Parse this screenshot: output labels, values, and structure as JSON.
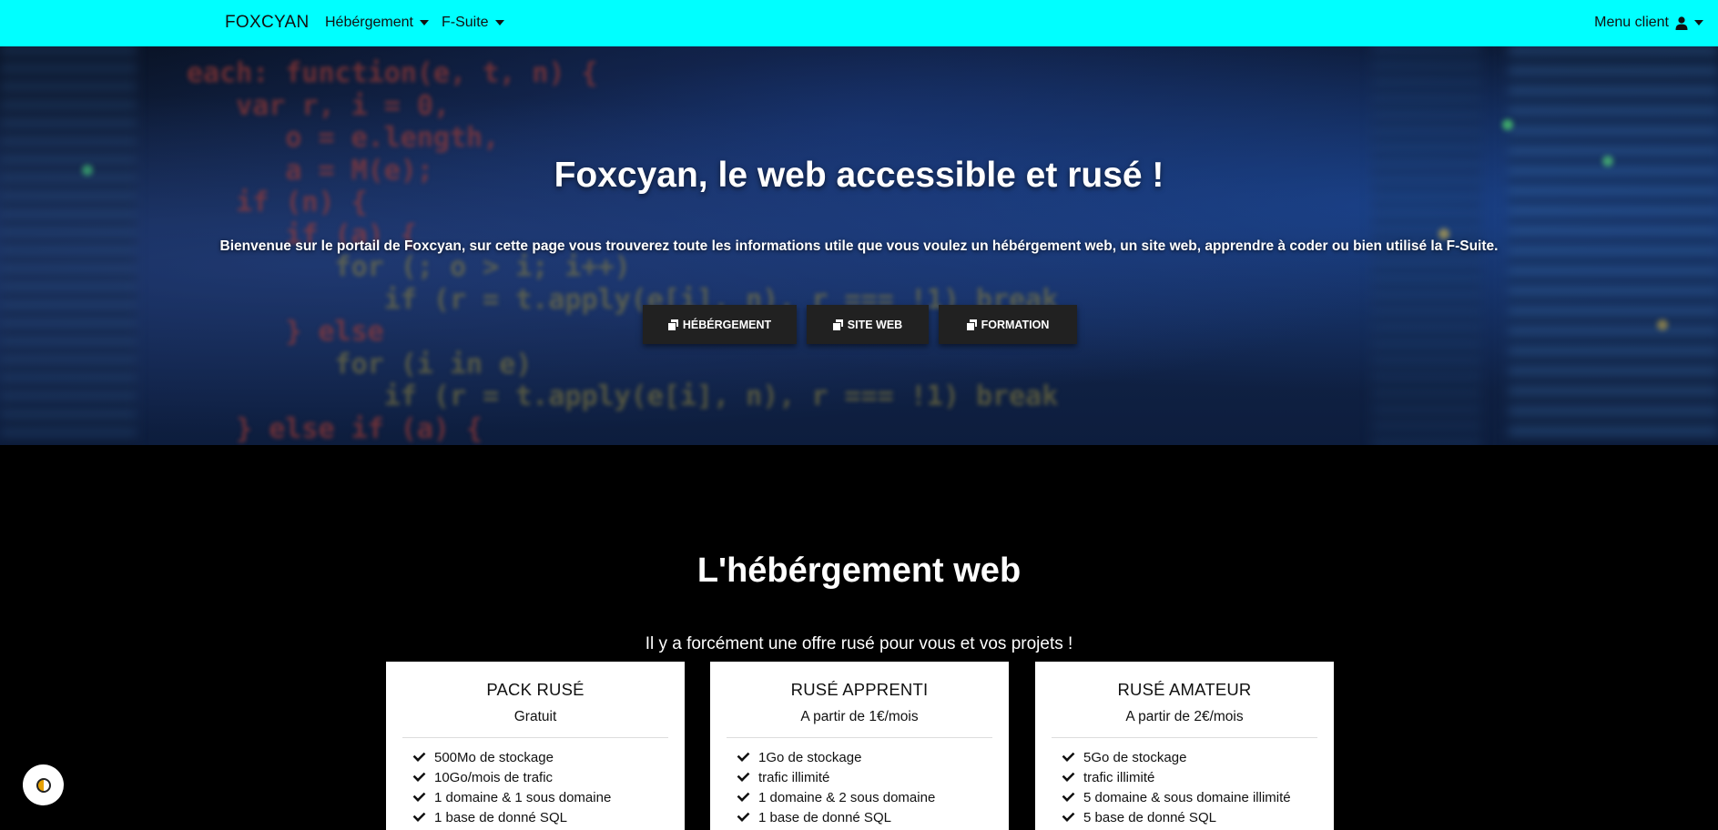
{
  "navbar": {
    "brand": "FOXCYAN",
    "items": [
      {
        "label": "Hébérgement"
      },
      {
        "label": "F-Suite"
      }
    ],
    "client_menu": "Menu client",
    "client_icon": "user-icon",
    "bg_color": "#00ffff"
  },
  "hero": {
    "title": "Foxcyan, le web accessible et rusé !",
    "description": "Bienvenue sur le portail de Foxcyan, sur cette page vous trouverez toute les informations utile que vous voulez un hébérgement web, un site web, apprendre à coder ou bien utilisé la F-Suite.",
    "code_lines": [
      "each: function(e, t, n) {",
      "   var r, i = 0,",
      "      o = e.length,",
      "      a = M(e);",
      "   if (n) {",
      "      if (a) {",
      "         for (; o > i; i++)",
      "            if (r = t.apply(e[i], n), r === !1) break",
      "      } else",
      "         for (i in e)",
      "            if (r = t.apply(e[i], n), r === !1) break",
      "   } else if (a) {"
    ],
    "buttons": [
      {
        "label": "HÉBÉRGEMENT",
        "icon": "copy-icon"
      },
      {
        "label": "SITE WEB",
        "icon": "copy-icon"
      },
      {
        "label": "FORMATION",
        "icon": "copy-icon"
      }
    ]
  },
  "hosting": {
    "title": "L'hébérgement web",
    "subtitle": "Il y a forcément une offre rusé pour vous et vos projets !",
    "plans": [
      {
        "name": "PACK RUSÉ",
        "price": "Gratuit",
        "features": [
          "500Mo de stockage",
          "10Go/mois de trafic",
          "1 domaine & 1 sous domaine",
          "1 base de donné SQL"
        ]
      },
      {
        "name": "RUSÉ APPRENTI",
        "price": "A partir de 1€/mois",
        "features": [
          "1Go de stockage",
          "trafic illimité",
          "1 domaine & 2 sous domaine",
          "1 base de donné SQL"
        ]
      },
      {
        "name": "RUSÉ AMATEUR",
        "price": "A partir de 2€/mois",
        "features": [
          "5Go de stockage",
          "trafic illimité",
          "5 domaine & sous domaine illimité",
          "5 base de donné SQL"
        ]
      }
    ]
  },
  "theme_toggle": {
    "icon": "contrast-icon"
  }
}
